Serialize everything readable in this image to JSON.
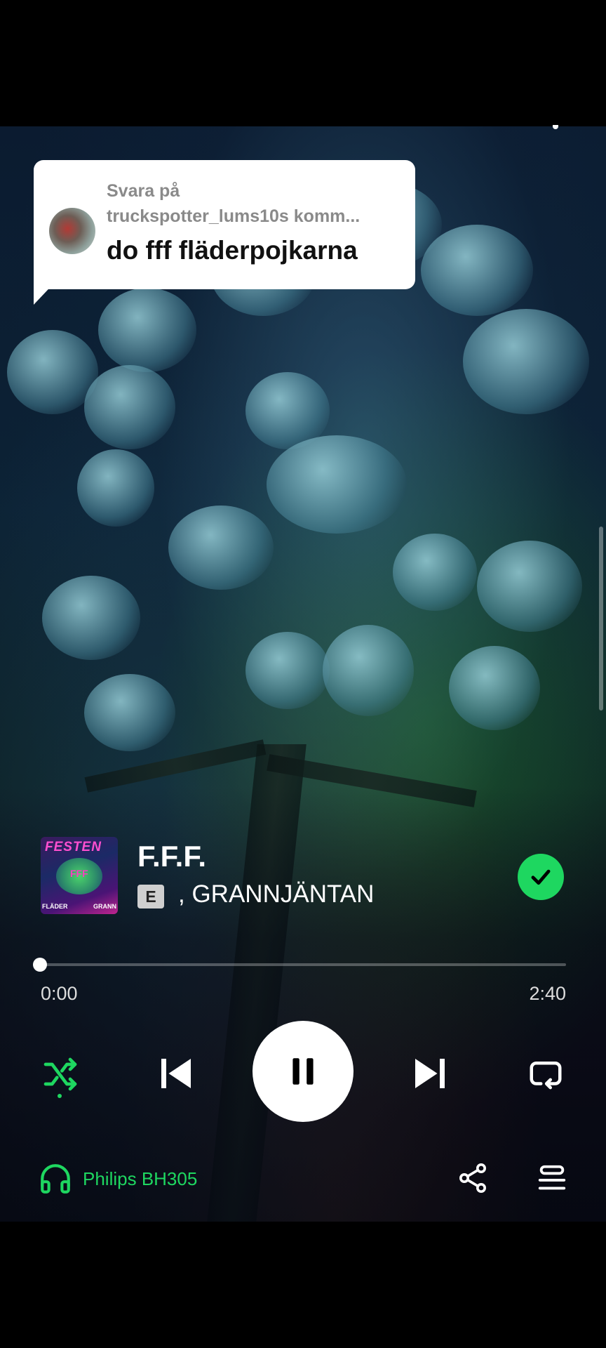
{
  "comment_reply": {
    "label": "Svara på",
    "username": "truckspotter_lums10s komm...",
    "text": "do fff fläderpojkarna"
  },
  "now_playing": {
    "cover_title": "FESTEN",
    "cover_center": "FFF",
    "cover_left": "FLÄDER",
    "cover_right": "GRANN",
    "title": "F.F.F.",
    "explicit_badge": "E",
    "artist": ", GRANNJÄNTAN",
    "liked": true
  },
  "progress": {
    "current": "0:00",
    "total": "2:40",
    "fraction": 0.0
  },
  "controls": {
    "shuffle_icon": "shuffle-icon",
    "previous_icon": "skip-previous-icon",
    "play_state_icon": "pause-icon",
    "next_icon": "skip-next-icon",
    "repeat_icon": "repeat-icon",
    "shuffle_active": true
  },
  "device": {
    "icon": "headphones-icon",
    "name": "Philips BH305"
  },
  "footer": {
    "share_icon": "share-icon",
    "queue_icon": "queue-icon"
  },
  "colors": {
    "accent": "#1ed760",
    "background": "#000000",
    "bubble": "#ffffff"
  }
}
